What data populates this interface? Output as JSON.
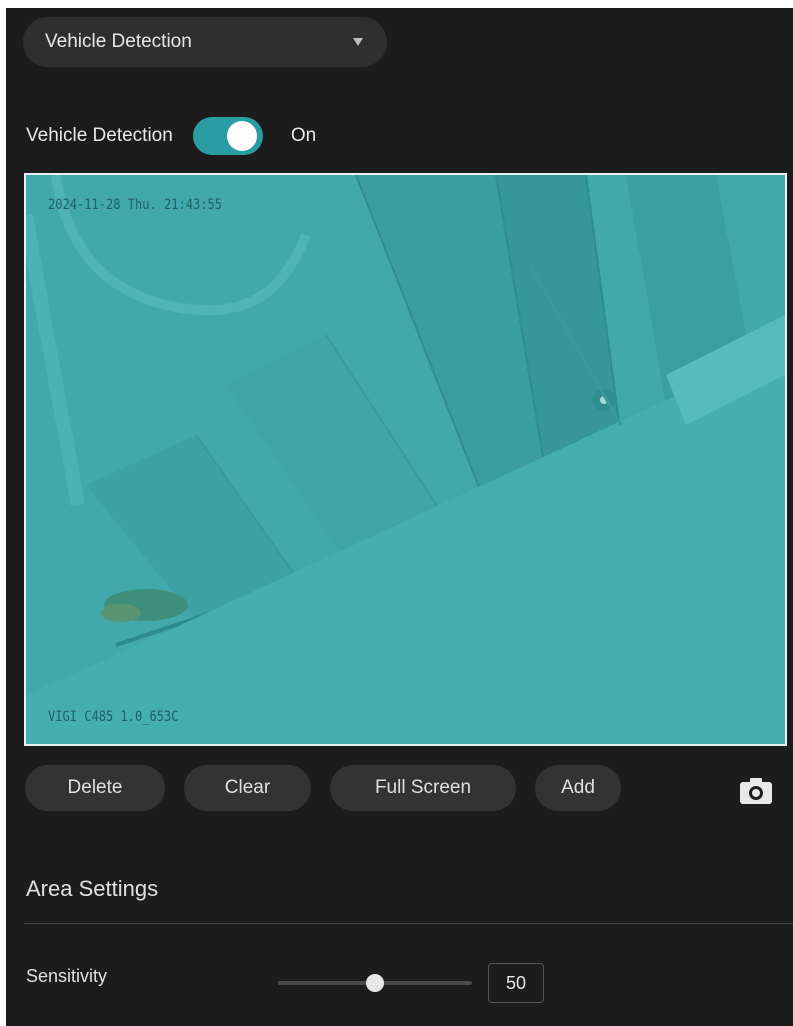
{
  "mode_select": {
    "value": "Vehicle Detection"
  },
  "detection": {
    "label": "Vehicle Detection",
    "enabled": true,
    "state": "On"
  },
  "preview": {
    "timestamp": "2024-11-28 Thu. 21:43:55",
    "camera_name": "VIGI C485 1.0_653C"
  },
  "actions": {
    "delete": "Delete",
    "clear": "Clear",
    "full_screen": "Full Screen",
    "add": "Add"
  },
  "area_settings": {
    "title": "Area Settings",
    "sensitivity_label": "Sensitivity",
    "sensitivity_value": "50",
    "sensitivity_fraction": 0.5
  },
  "colors": {
    "accent": "#2a9da3",
    "overlay": "#41a9ab",
    "background": "#1c1c1c"
  }
}
